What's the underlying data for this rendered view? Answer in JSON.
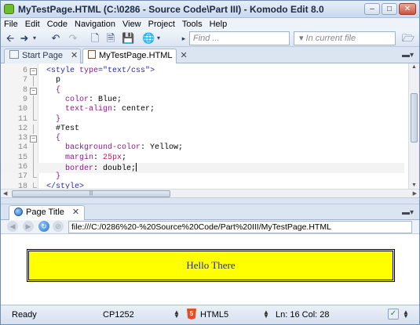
{
  "window": {
    "title": "MyTestPage.HTML (C:\\0286 - Source Code\\Part III) - Komodo Edit 8.0"
  },
  "menu": [
    "File",
    "Edit",
    "Code",
    "Navigation",
    "View",
    "Project",
    "Tools",
    "Help"
  ],
  "toolbar": {
    "find_placeholder": "Find ...",
    "scope_placeholder": "In current file"
  },
  "editor_tabs": [
    {
      "label": "Start Page",
      "close": "✕",
      "active": false
    },
    {
      "label": "MyTestPage.HTML",
      "close": "✕",
      "active": true
    }
  ],
  "code_lines": [
    {
      "n": "6",
      "fold": "box",
      "html": "<span class=\"c-tag\">&lt;style </span><span class=\"c-attr\">type</span><span class=\"c-tag\">=</span><span class=\"c-str\">\"text/css\"</span><span class=\"c-tag\">&gt;</span>",
      "indent": 4
    },
    {
      "n": "7",
      "fold": "line",
      "html": "<span class=\"c-sel\">p</span>",
      "indent": 6
    },
    {
      "n": "8",
      "fold": "box",
      "html": "<span class=\"c-brace\">{</span>",
      "indent": 6
    },
    {
      "n": "9",
      "fold": "line",
      "html": "<span class=\"c-prop\">color</span>: <span class=\"c-val\">Blue</span>;",
      "indent": 8
    },
    {
      "n": "10",
      "fold": "line",
      "html": "<span class=\"c-prop\">text-align</span>: <span class=\"c-val\">center</span>;",
      "indent": 8
    },
    {
      "n": "11",
      "fold": "end",
      "html": "<span class=\"c-brace\">}</span>",
      "indent": 6
    },
    {
      "n": "12",
      "fold": "line",
      "html": "<span class=\"c-sel\">#Test</span>",
      "indent": 6
    },
    {
      "n": "13",
      "fold": "box",
      "html": "<span class=\"c-brace\">{</span>",
      "indent": 6
    },
    {
      "n": "14",
      "fold": "line",
      "html": "<span class=\"c-prop\">background-color</span>: <span class=\"c-val\">Yellow</span>;",
      "indent": 8
    },
    {
      "n": "15",
      "fold": "line",
      "html": "<span class=\"c-prop\">margin</span>: <span class=\"c-num\">25px</span>;",
      "indent": 8
    },
    {
      "n": "16",
      "fold": "line",
      "html": "<span class=\"c-prop\">border</span>: <span class=\"c-val\">double</span>;<span class=\"cursor\"></span>",
      "indent": 8,
      "current": true
    },
    {
      "n": "17",
      "fold": "end",
      "html": "<span class=\"c-brace\">}</span>",
      "indent": 6
    },
    {
      "n": "18",
      "fold": "end",
      "html": "<span class=\"c-tag\">&lt;/style&gt;</span>",
      "indent": 4
    }
  ],
  "preview": {
    "tab_label": "Page Title",
    "tab_close": "✕",
    "url": "file:///C:/0286%20-%20Source%20Code/Part%20III/MyTestPage.HTML",
    "body_text": "Hello There",
    "box_color": "#ffff00",
    "text_color": "#1f2ba8"
  },
  "status": {
    "ready": "Ready",
    "encoding": "CP1252",
    "language": "HTML5",
    "position": "Ln: 16 Col: 28"
  }
}
